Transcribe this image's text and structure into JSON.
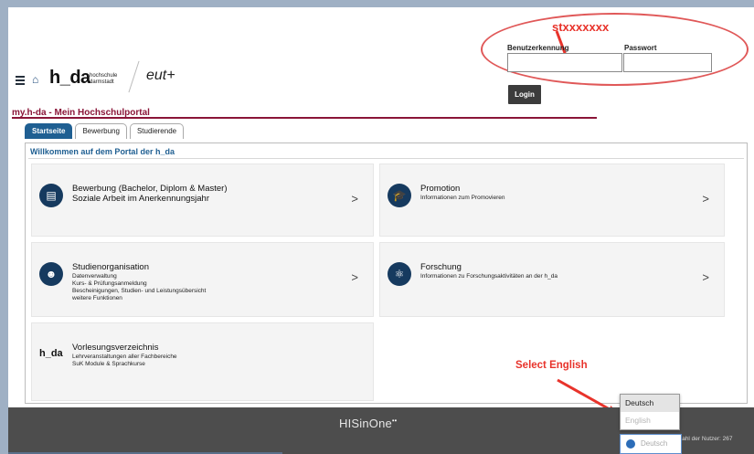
{
  "header": {
    "logo_text": "h_da",
    "logo_subtitle_line1": "hochschule",
    "logo_subtitle_line2": "darmstadt",
    "partner_logo": "eut+",
    "username_label": "Benutzerkennung",
    "password_label": "Passwort",
    "username_value": "",
    "password_value": "",
    "login_label": "Login",
    "username_hint": "stxxxxxxx"
  },
  "portal": {
    "title": "my.h-da - Mein Hochschulportal",
    "tabs": [
      "Startseite",
      "Bewerbung",
      "Studierende"
    ],
    "welcome": "Willkommen auf dem Portal der h_da"
  },
  "cards": [
    {
      "icon": "document-icon",
      "title_line1": "Bewerbung (Bachelor, Diplom & Master)",
      "title_line2": "Soziale Arbeit im Anerkennungsjahr",
      "lines": []
    },
    {
      "icon": "graduation-cap-icon",
      "title_line1": "Promotion",
      "title_line2": "",
      "lines": [
        "Informationen zum Promovieren"
      ]
    },
    {
      "icon": "people-icon",
      "title_line1": "Studienorganisation",
      "title_line2": "",
      "lines": [
        "Datenverwaltung",
        "Kurs- & Prüfungsanmeldung",
        "Bescheinigungen, Studien- und Leistungsübersicht",
        "weitere Funktionen"
      ]
    },
    {
      "icon": "microscope-icon",
      "title_line1": "Forschung",
      "title_line2": "",
      "lines": [
        "Informationen zu Forschungsaktivitäten an der h_da"
      ]
    },
    {
      "icon": "hda-logo",
      "title_line1": "Vorlesungsverzeichnis",
      "title_line2": "",
      "lines": [
        "Lehrveranstaltungen aller Fachbereiche",
        "SuK Module & Sprachkurse"
      ]
    }
  ],
  "annotations": {
    "select_english": "Select English"
  },
  "footer": {
    "brand": "HISinOne",
    "user_count": "Anzahl der Nutzer: 267",
    "language_options": [
      "Deutsch",
      "English"
    ],
    "language_selected": "Deutsch"
  },
  "colors": {
    "brand_red": "#8a1538",
    "accent_blue": "#1f5f92",
    "icon_navy": "#163a5f",
    "annotation_red": "#e8332b"
  }
}
